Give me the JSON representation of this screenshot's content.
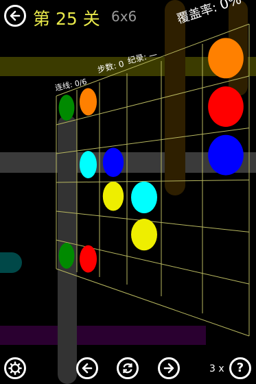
{
  "header": {
    "level_title": "第 25 关",
    "grid_size": "6x6",
    "coverage_label": "覆盖率:",
    "coverage_value": "0%"
  },
  "stats": {
    "links": "连线: 0/6",
    "moves": "步数: 0",
    "record": "纪录: —"
  },
  "footer": {
    "hints_count": "3 x",
    "help_glyph": "?"
  },
  "colors": {
    "red": "#ff0000",
    "green": "#008a00",
    "blue": "#0000ff",
    "yellow": "#eeee00",
    "orange": "#ff8000",
    "cyan": "#00ffff",
    "grid_line": "#b8b860"
  },
  "board": {
    "rows": 6,
    "cols": 6,
    "dots": [
      {
        "color": "green",
        "row": 0,
        "col": 0
      },
      {
        "color": "orange",
        "row": 0,
        "col": 1
      },
      {
        "color": "orange",
        "row": 0,
        "col": 5
      },
      {
        "color": "red",
        "row": 1,
        "col": 5
      },
      {
        "color": "cyan",
        "row": 2,
        "col": 1
      },
      {
        "color": "blue",
        "row": 2,
        "col": 2
      },
      {
        "color": "blue",
        "row": 2,
        "col": 5
      },
      {
        "color": "yellow",
        "row": 3,
        "col": 2
      },
      {
        "color": "cyan",
        "row": 3,
        "col": 3
      },
      {
        "color": "yellow",
        "row": 4,
        "col": 3
      },
      {
        "color": "green",
        "row": 5,
        "col": 0
      },
      {
        "color": "red",
        "row": 5,
        "col": 1
      }
    ]
  }
}
